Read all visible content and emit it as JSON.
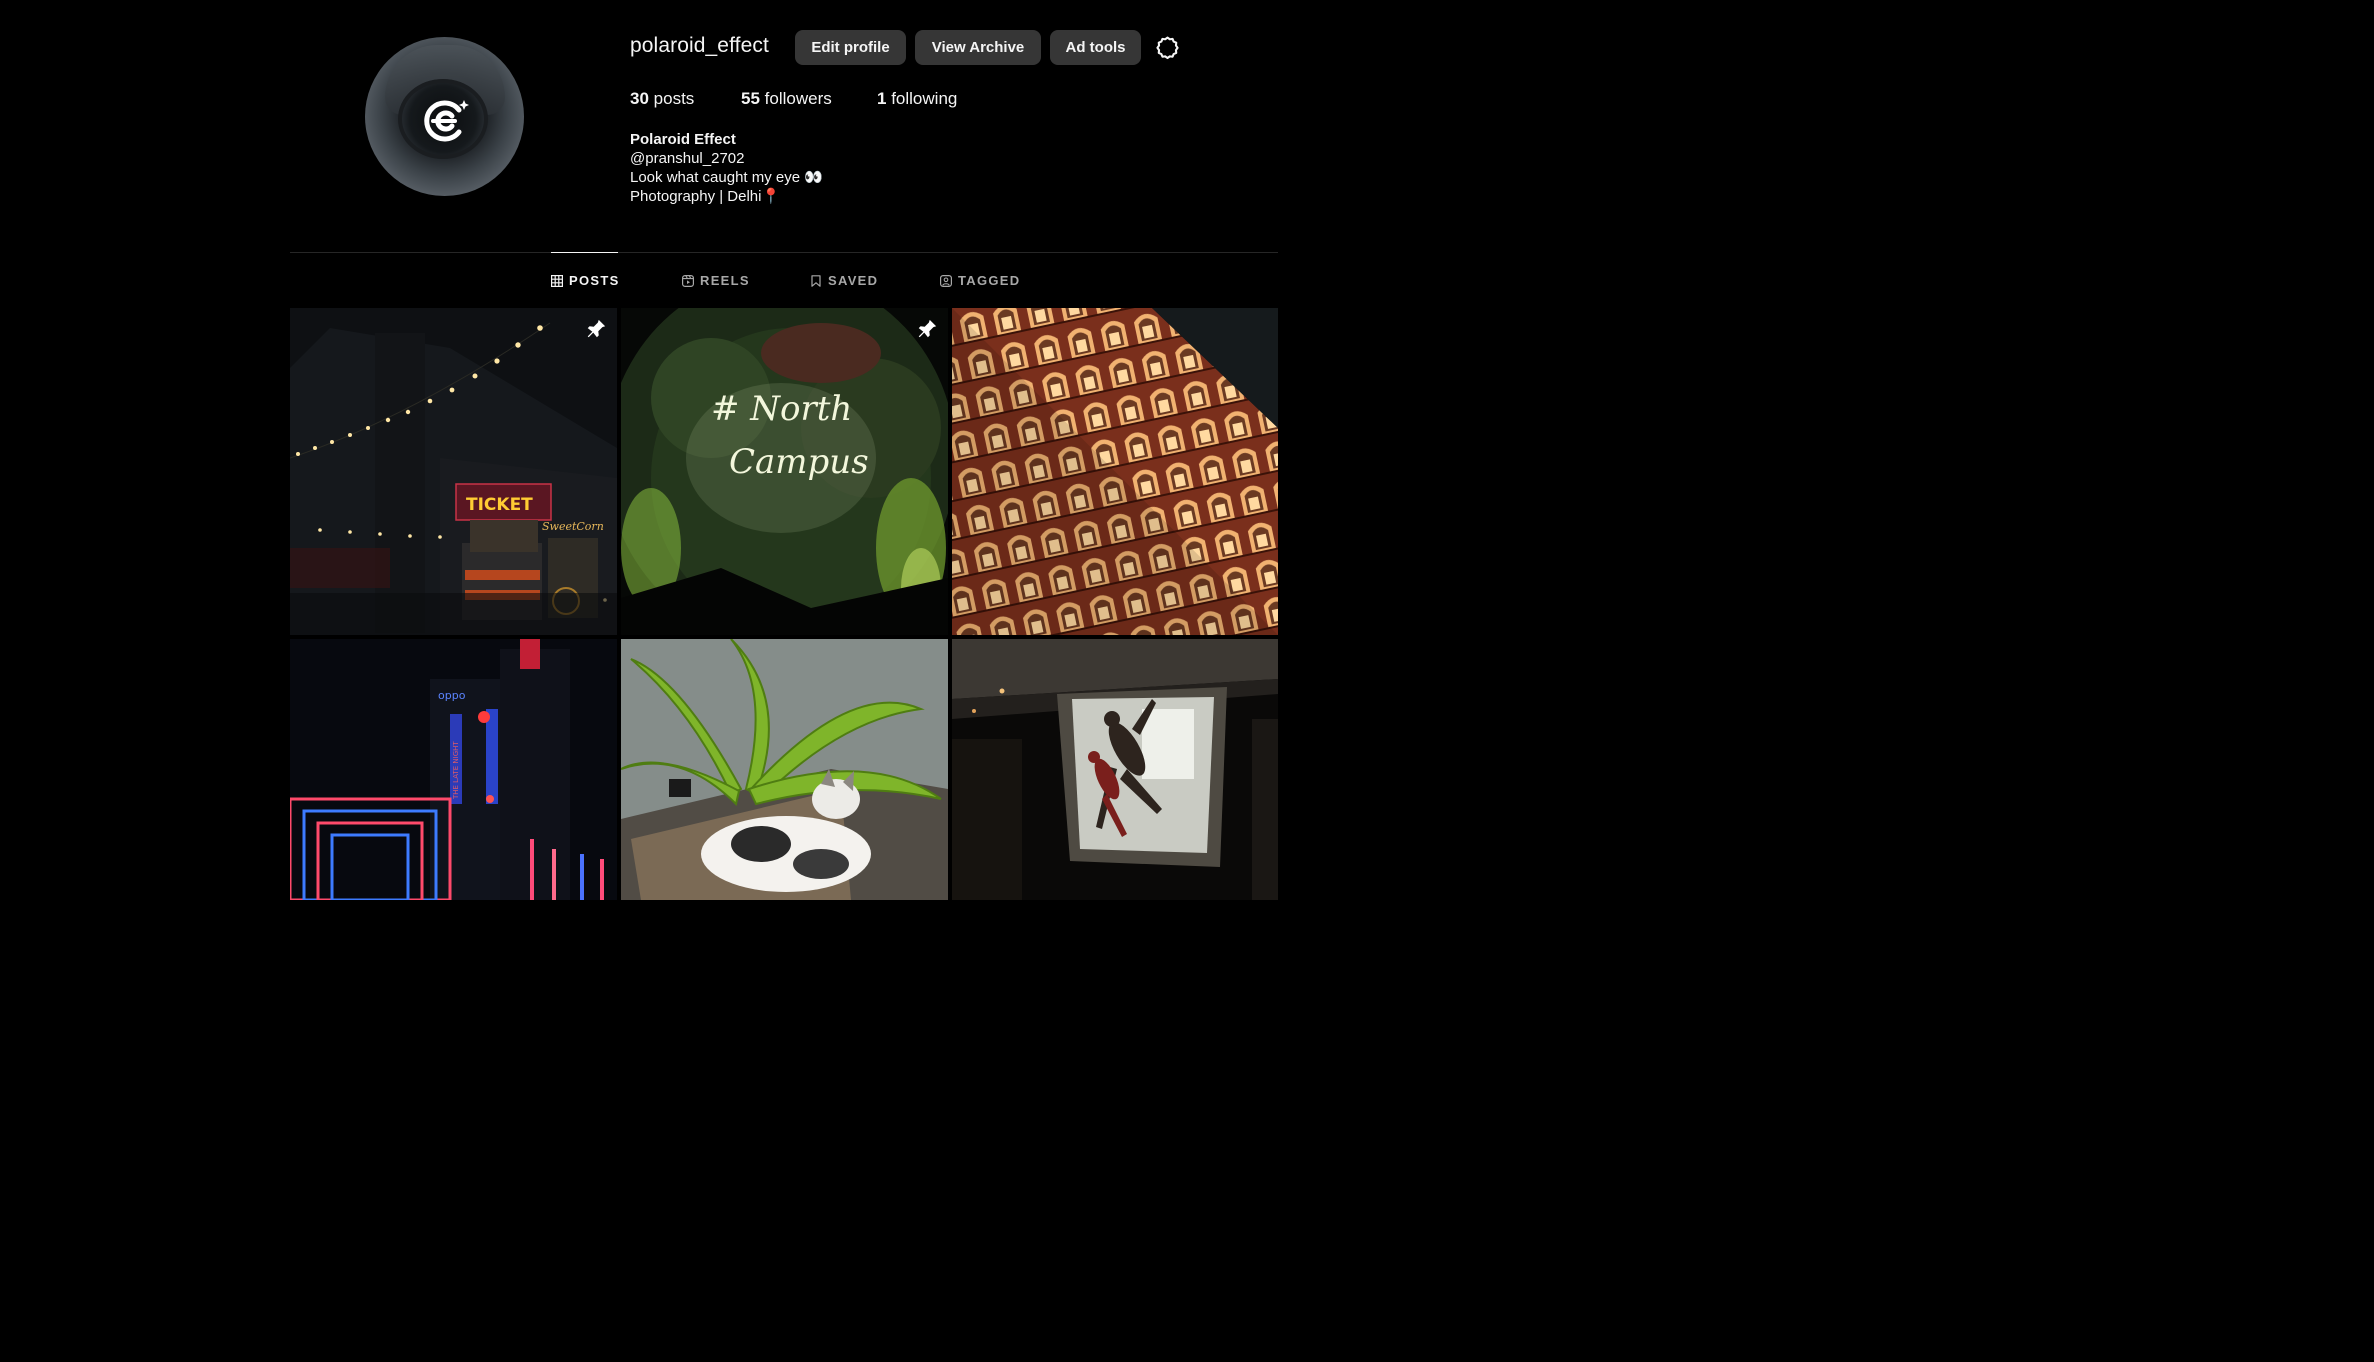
{
  "profile": {
    "username": "polaroid_effect",
    "edit_label": "Edit profile",
    "archive_label": "View Archive",
    "ad_tools_label": "Ad tools",
    "settings_icon": "settings-gear-icon",
    "stats": {
      "posts_count": "30",
      "posts_label": "posts",
      "followers_count": "55",
      "followers_label": "followers",
      "following_count": "1",
      "following_label": "following"
    },
    "bio": {
      "display_name": "Polaroid Effect",
      "handle": "@pranshul_2702",
      "line1": "Look what caught my eye 👀",
      "line2": "Photography | Delhi📍"
    }
  },
  "tabs": [
    {
      "label": "POSTS",
      "icon": "grid-icon",
      "active": true
    },
    {
      "label": "REELS",
      "icon": "reels-icon",
      "active": false
    },
    {
      "label": "SAVED",
      "icon": "bookmark-icon",
      "active": false
    },
    {
      "label": "TAGGED",
      "icon": "tagged-person-icon",
      "active": false
    }
  ],
  "posts": [
    {
      "subject": "night carnival ticket booth with string lights",
      "pinned": true
    },
    {
      "subject": "neon sign North Campus on foliage wall",
      "pinned": true
    },
    {
      "subject": "Hawa Mahal facade lit at night",
      "pinned": false
    },
    {
      "subject": "neon arches and city lights at night",
      "pinned": false
    },
    {
      "subject": "cat sleeping under potted plant",
      "pinned": false
    },
    {
      "subject": "figures silhouetted in a window",
      "pinned": false
    }
  ],
  "colors": {
    "background": "#000000",
    "button_bg": "#363636",
    "text": "#f5f5f5",
    "muted": "#a8a8a8",
    "divider": "#262626"
  },
  "neon_text": {
    "ticket": "TICKET",
    "north": "# North",
    "campus": "Campus",
    "sweet": "SweetCorn",
    "oppo": "oppo",
    "late_night": "THE LATE NIGHT"
  }
}
